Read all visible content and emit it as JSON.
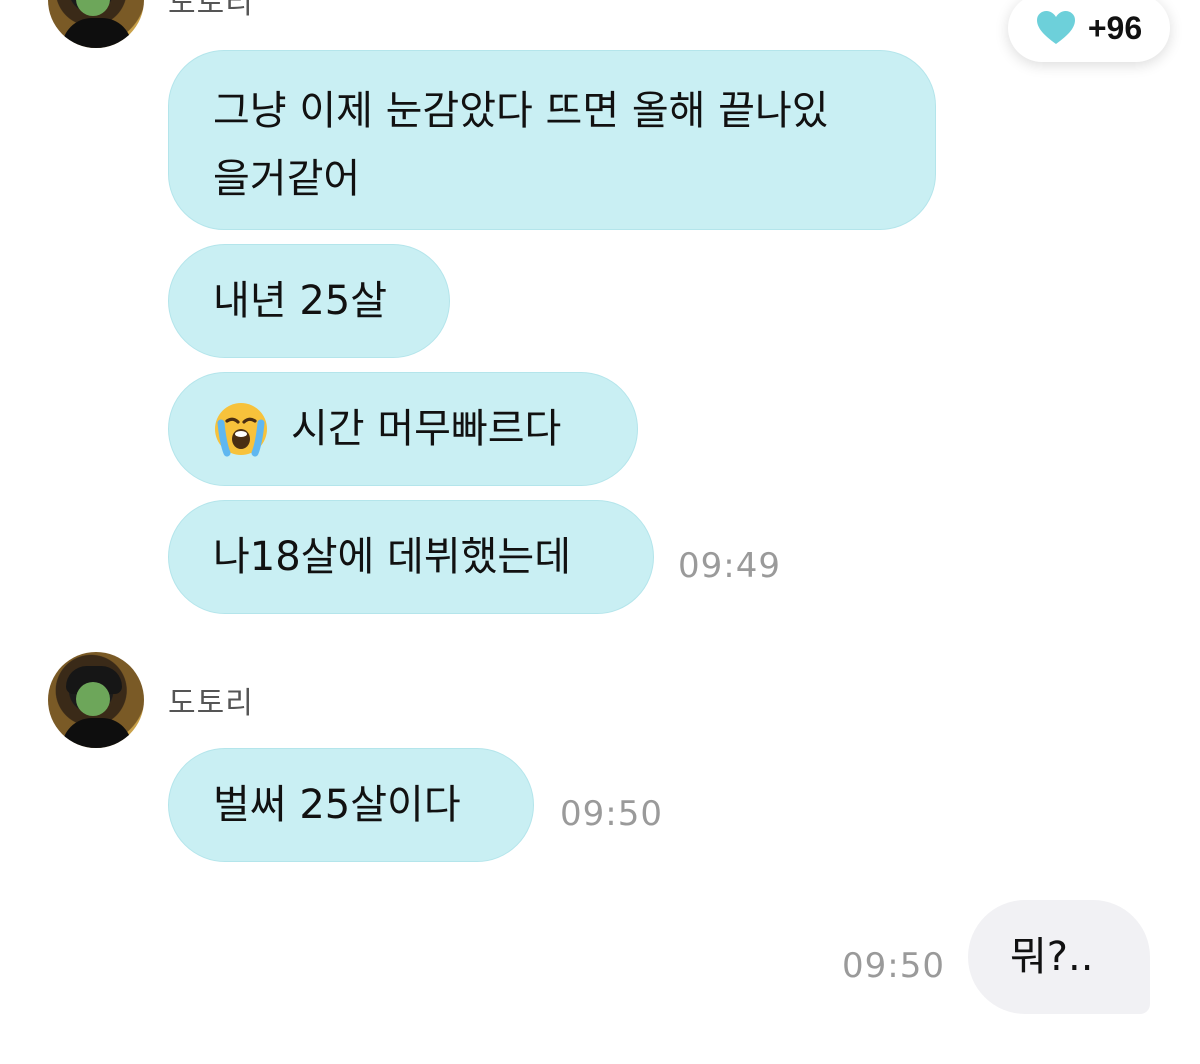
{
  "reaction": {
    "icon": "heart-icon",
    "count": "+96",
    "color": "#6dd0da"
  },
  "colors": {
    "incoming_bubble": "#c9eff3",
    "outgoing_bubble": "#f1f1f4",
    "timestamp": "#9a9a9a"
  },
  "groups": [
    {
      "sender": "도토리",
      "messages": [
        {
          "text": "그냥 이제 눈감았다 뜨면 올해 끝나있 을거같어",
          "line1": "그냥 이제 눈감았다 뜨면 올해 끝나있",
          "line2": "을거같어"
        },
        {
          "text": "내년 25살"
        },
        {
          "emoji": "loudly-crying-face-icon",
          "text": "시간 머무빠르다"
        },
        {
          "text": "나18살에 데뷔했는데",
          "time": "09:49"
        }
      ]
    },
    {
      "sender": "도토리",
      "messages": [
        {
          "text": "벌써 25살이다",
          "time": "09:50"
        }
      ]
    }
  ],
  "outgoing": [
    {
      "text": "뭐?..",
      "time": "09:50"
    }
  ]
}
